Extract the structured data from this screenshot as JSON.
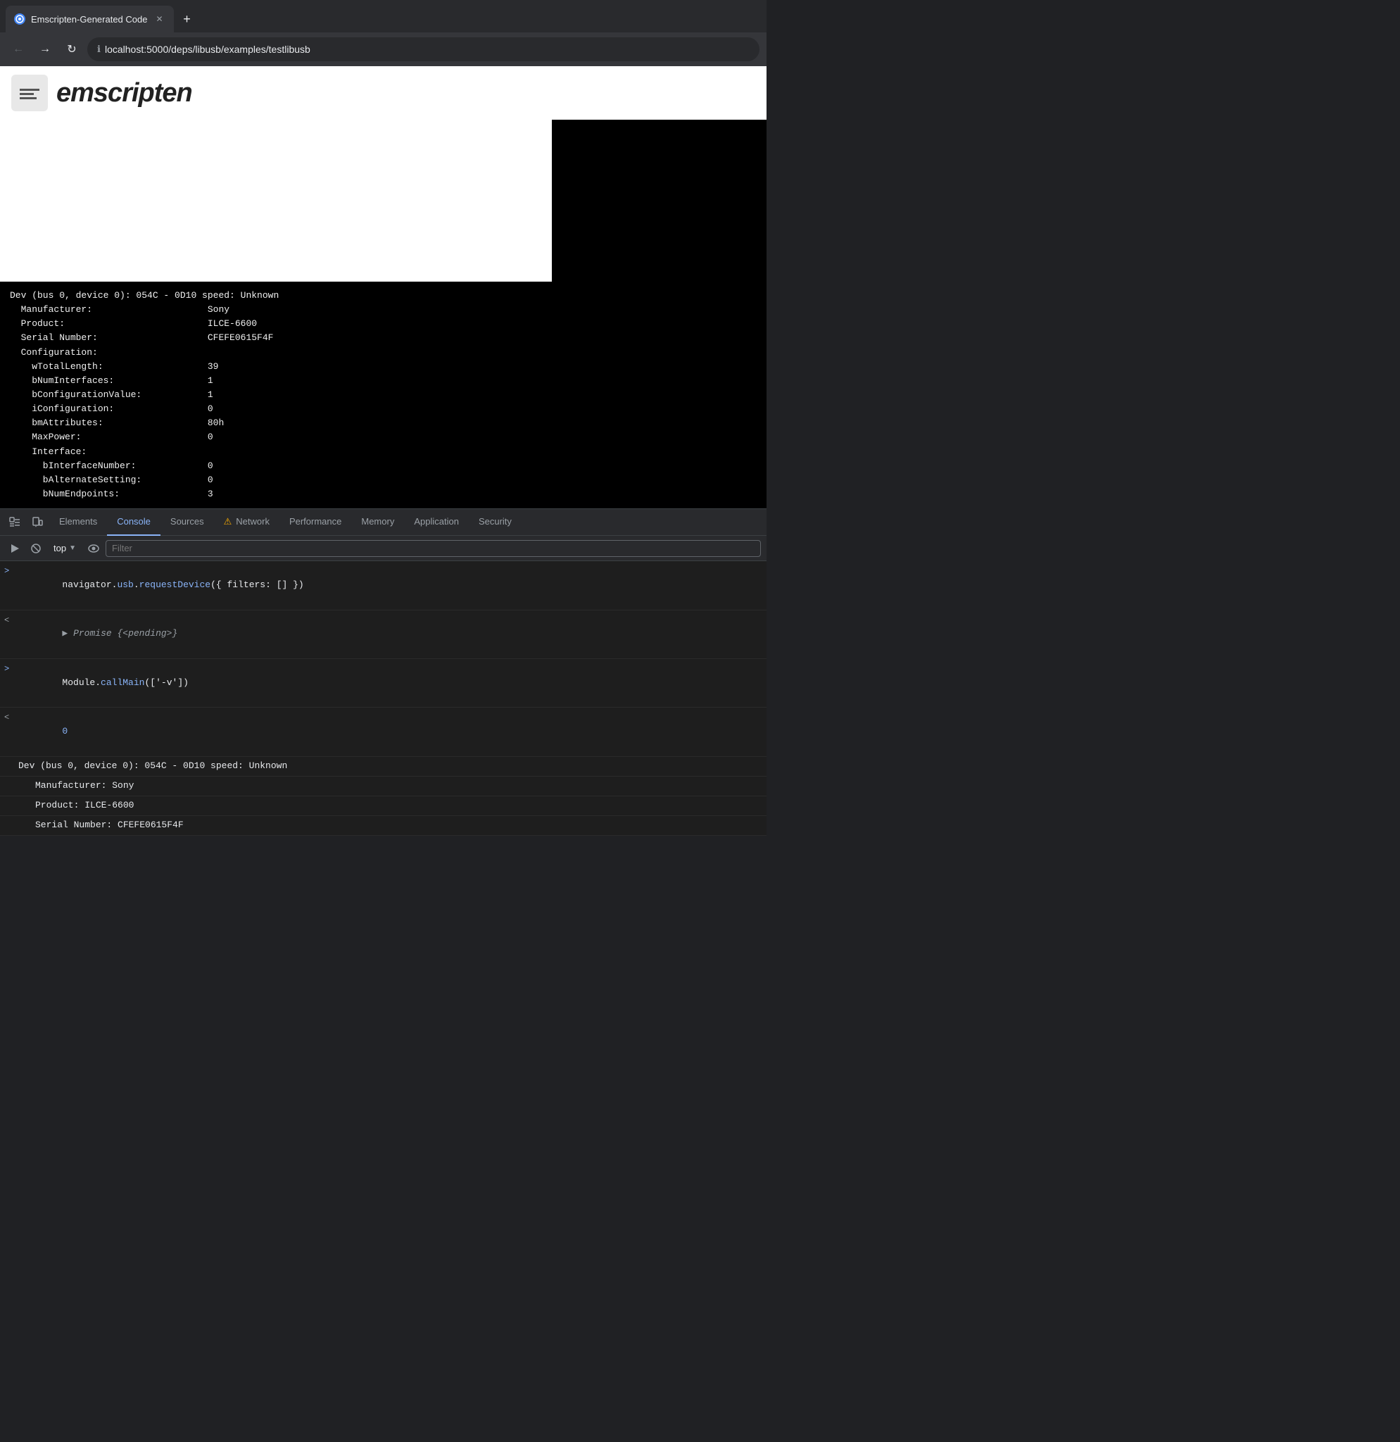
{
  "browser": {
    "tab": {
      "title": "Emscripten-Generated Code",
      "favicon": "🌐"
    },
    "new_tab_icon": "+",
    "nav": {
      "back": "←",
      "forward": "→",
      "reload": "↻"
    },
    "address": "localhost:5000/deps/libusb/examples/testlibusb",
    "address_icon": "ℹ"
  },
  "page": {
    "logo_placeholder": "📦",
    "title": "emscripten"
  },
  "terminal": {
    "lines": [
      "Dev (bus 0, device 0): 054C - 0D10 speed: Unknown",
      "  Manufacturer:                     Sony",
      "  Product:                          ILCE-6600",
      "  Serial Number:                    CFEFE0615F4F",
      "  Configuration:",
      "    wTotalLength:                   39",
      "    bNumInterfaces:                 1",
      "    bConfigurationValue:            1",
      "    iConfiguration:                 0",
      "    bmAttributes:                   80h",
      "    MaxPower:                       0",
      "    Interface:",
      "      bInterfaceNumber:             0",
      "      bAlternateSetting:            0",
      "      bNumEndpoints:                3"
    ]
  },
  "devtools": {
    "tabs": [
      {
        "label": "Elements",
        "active": false
      },
      {
        "label": "Console",
        "active": true
      },
      {
        "label": "Sources",
        "active": false
      },
      {
        "label": "Network",
        "active": false,
        "warning": true
      },
      {
        "label": "Performance",
        "active": false
      },
      {
        "label": "Memory",
        "active": false
      },
      {
        "label": "Application",
        "active": false
      },
      {
        "label": "Security",
        "active": false
      }
    ],
    "toolbar": {
      "top_label": "top",
      "filter_placeholder": "Filter"
    },
    "console": {
      "lines": [
        {
          "type": "input",
          "arrow": ">",
          "parts": [
            {
              "text": "navigator",
              "color": "white"
            },
            {
              "text": ".",
              "color": "white"
            },
            {
              "text": "usb",
              "color": "blue"
            },
            {
              "text": ".",
              "color": "white"
            },
            {
              "text": "requestDevice",
              "color": "blue"
            },
            {
              "text": "({ filters: [] })",
              "color": "white"
            }
          ]
        },
        {
          "type": "return",
          "arrow": "◀",
          "parts": [
            {
              "text": "▶ ",
              "color": "gray"
            },
            {
              "text": "Promise {<pending>}",
              "color": "italic_gray"
            }
          ]
        },
        {
          "type": "input",
          "arrow": ">",
          "parts": [
            {
              "text": "Module",
              "color": "white"
            },
            {
              "text": ".",
              "color": "white"
            },
            {
              "text": "callMain",
              "color": "blue"
            },
            {
              "text": "(['-v'])",
              "color": "white"
            }
          ]
        },
        {
          "type": "return",
          "arrow": "◀",
          "parts": [
            {
              "text": "0",
              "color": "blue"
            }
          ]
        },
        {
          "type": "log",
          "arrow": "",
          "text": "Dev (bus 0, device 0): 054C - 0D10 speed: Unknown"
        },
        {
          "type": "log",
          "arrow": "",
          "indent": "    ",
          "text": "Manufacturer:                     Sony"
        },
        {
          "type": "log",
          "arrow": "",
          "indent": "    ",
          "text": "Product:                          ILCE-6600"
        },
        {
          "type": "log",
          "arrow": "",
          "indent": "    ",
          "text": "Serial Number:                    CFEFE0615F4F"
        }
      ]
    }
  }
}
